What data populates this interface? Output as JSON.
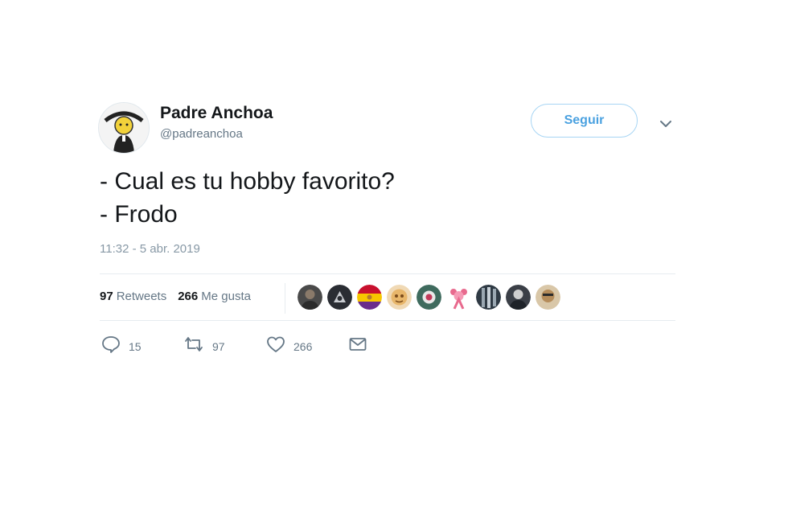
{
  "user": {
    "display_name": "Padre Anchoa",
    "handle": "@padreanchoa",
    "avatar_icon": "caricature-avatar"
  },
  "follow": {
    "label": "Seguir"
  },
  "menu_icon": "chevron-down-icon",
  "tweet": {
    "lines": [
      "- Cual es tu hobby favorito?",
      "- Frodo"
    ],
    "timestamp": "11:32 - 5 abr. 2019"
  },
  "stats": {
    "retweets_count": "97",
    "retweets_label": "Retweets",
    "likes_count": "266",
    "likes_label": "Me gusta"
  },
  "likers": [
    {
      "icon": "profile-photo"
    },
    {
      "icon": "profile-photo"
    },
    {
      "icon": "flag-republic-avatar"
    },
    {
      "icon": "profile-photo"
    },
    {
      "icon": "profile-photo"
    },
    {
      "icon": "pink-figure-avatar"
    },
    {
      "icon": "profile-photo"
    },
    {
      "icon": "profile-photo"
    },
    {
      "icon": "profile-photo"
    }
  ],
  "actions": {
    "reply_count": "15",
    "retweet_count": "97",
    "like_count": "266"
  },
  "colors": {
    "accent": "#4aa1e0",
    "follow_border": "#a7d5f4",
    "text": "#14171a",
    "secondary_text": "#657786",
    "divider": "#e6ecf0"
  }
}
